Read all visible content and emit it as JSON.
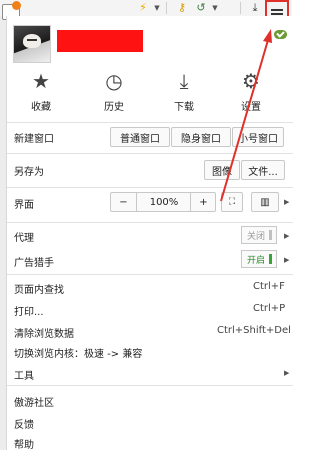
{
  "toolbar": {
    "icons": [
      "lightning-icon",
      "dropdown-arrow-icon",
      "key-icon",
      "undo-icon",
      "dropdown-arrow-icon",
      "download-icon",
      "menu-icon"
    ]
  },
  "quick_actions": [
    {
      "label": "收藏",
      "icon": "star-icon"
    },
    {
      "label": "历史",
      "icon": "clock-icon"
    },
    {
      "label": "下载",
      "icon": "download-icon"
    },
    {
      "label": "设置",
      "icon": "gear-icon"
    }
  ],
  "new_window": {
    "label": "新建窗口",
    "buttons": [
      "普通窗口",
      "隐身窗口",
      "小号窗口"
    ]
  },
  "save_as": {
    "label": "另存为",
    "buttons": [
      "图像",
      "文件..."
    ]
  },
  "interface": {
    "label": "界面",
    "minus": "−",
    "zoom": "100%",
    "plus": "+"
  },
  "proxy": {
    "label": "代理",
    "state": "关闭"
  },
  "adblock": {
    "label": "广告猎手",
    "state": "开启"
  },
  "menu_items": [
    {
      "label": "页面内查找",
      "shortcut": "Ctrl+F"
    },
    {
      "label": "打印...",
      "shortcut": "Ctrl+P"
    },
    {
      "label": "清除浏览数据",
      "shortcut": "Ctrl+Shift+Del"
    },
    {
      "label": "切换浏览内核：极速 -> 兼容",
      "shortcut": ""
    }
  ],
  "tools": {
    "label": "工具"
  },
  "footer_items": [
    "傲游社区",
    "反馈",
    "帮助"
  ],
  "colors": {
    "highlight": "#e0302a",
    "redaction": "#ff1212",
    "sync_ok": "#6c9a33",
    "toggle_on": "#3aa23a"
  }
}
